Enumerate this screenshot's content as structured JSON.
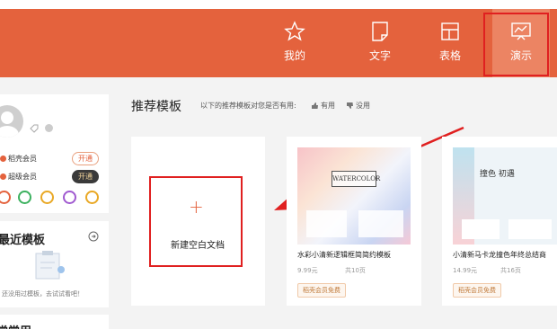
{
  "nav": {
    "items": [
      {
        "label": "我的",
        "icon": "star-icon"
      },
      {
        "label": "文字",
        "icon": "document-icon"
      },
      {
        "label": "表格",
        "icon": "table-icon"
      },
      {
        "label": "演示",
        "icon": "presentation-icon"
      }
    ],
    "active": "演示",
    "colors": {
      "header": "#e4623d",
      "active": "#ec8463",
      "highlight": "#e02020"
    }
  },
  "sidebar": {
    "members": [
      {
        "label": "稻壳会员",
        "action": "开通",
        "color": "#e4623d"
      },
      {
        "label": "超级会员",
        "action": "开通",
        "color": "#e4623d"
      }
    ],
    "recent_title": "最近模板",
    "recent_empty": "还没用过模板，去试试看吧！",
    "bottom_title": "常常用"
  },
  "main": {
    "title": "推荐模板",
    "subtitle": "以下的推荐模板对您是否有用:",
    "useful": "有用",
    "useless": "没用",
    "new_blank": {
      "icon": "+",
      "label": "新建空白文档"
    },
    "templates": [
      {
        "title": "水彩小清新逻辑框简简约模板",
        "price": "9.99元",
        "pages": "共10页",
        "badge": "稻壳会员免费",
        "thumb_text": "WATERCOLOR"
      },
      {
        "title": "小清新马卡龙撞色年终总结商",
        "price": "14.99元",
        "pages": "共16页",
        "badge": "稻壳会员免费",
        "thumb_text": "撞色 初遇"
      }
    ]
  }
}
